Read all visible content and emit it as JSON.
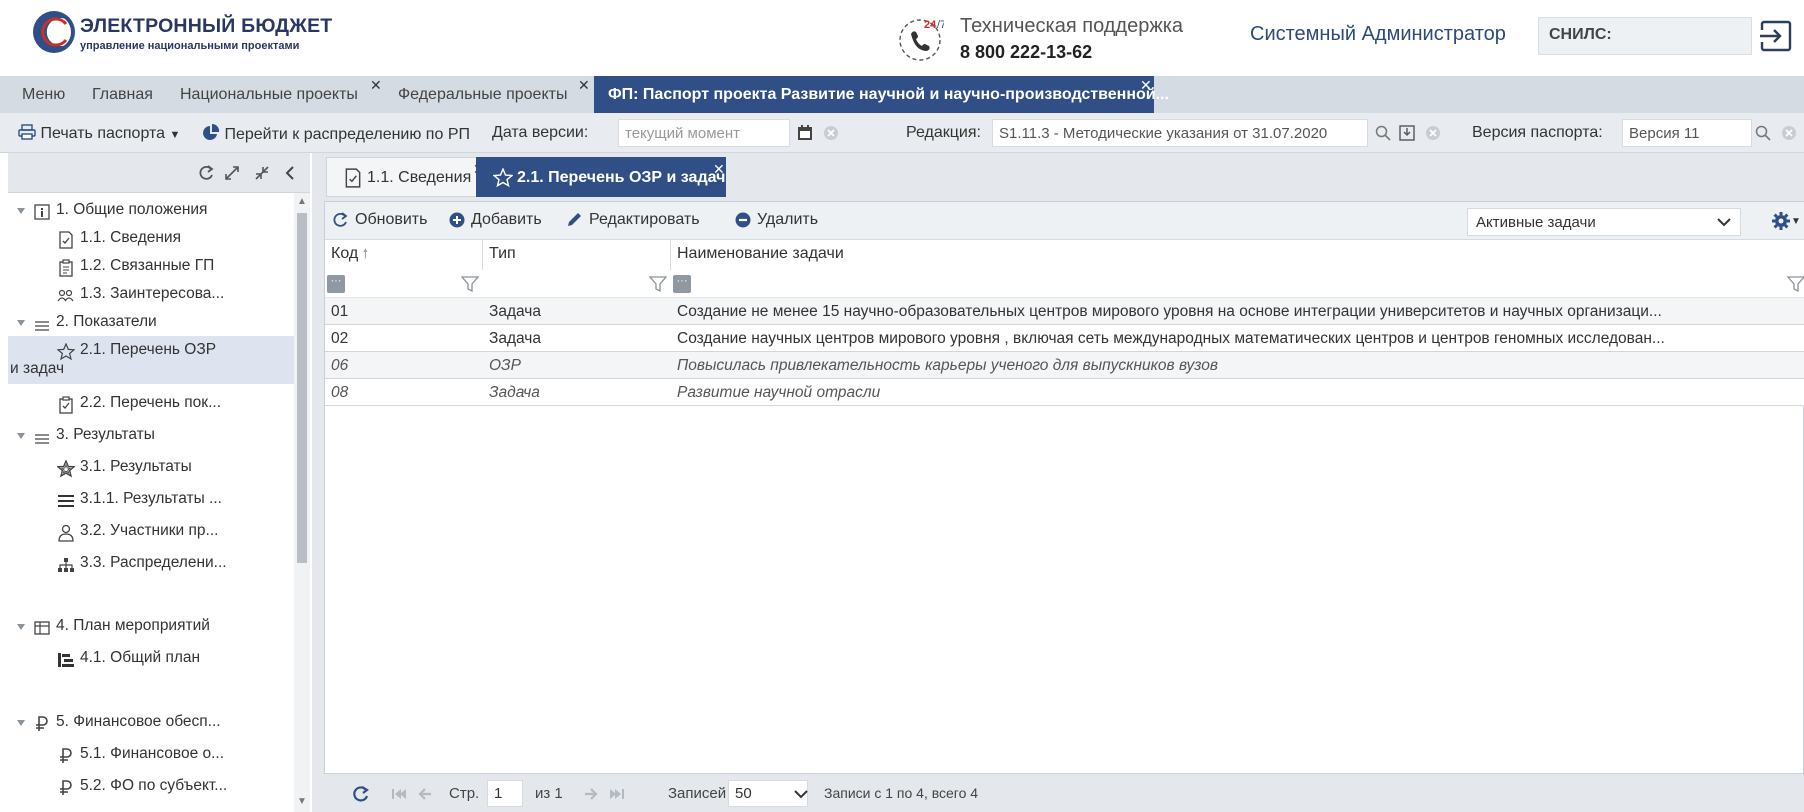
{
  "header": {
    "logo_title": "ЭЛЕКТРОННЫЙ БЮДЖЕТ",
    "logo_subtitle": "управление национальными проектами",
    "support_badge": "24/7",
    "support_title": "Техническая поддержка",
    "support_phone": "8 800 222-13-62",
    "user_name": "Системный Администратор",
    "snils_label": "СНИЛС:"
  },
  "main_tabs": [
    {
      "label": "Меню"
    },
    {
      "label": "Главная"
    },
    {
      "label": "Национальные проекты"
    },
    {
      "label": "Федеральные проекты"
    },
    {
      "label": "ФП: Паспорт проекта Развитие научной и научно-производственной..."
    }
  ],
  "toolbar": {
    "print_label": "Печать паспорта",
    "distribute_label": "Перейти к распределению по РП",
    "version_date_label": "Дата версии:",
    "version_date_placeholder": "текущий момент",
    "edition_label": "Редакция:",
    "edition_value": "S1.11.3 - Методические указания от 31.07.2020",
    "passport_version_label": "Версия паспорта:",
    "passport_version_value": "Версия 11"
  },
  "tree": [
    {
      "label": "1. Общие положения",
      "icon": "info-box-icon",
      "level": 0,
      "expanded": true
    },
    {
      "label": "1.1. Сведения",
      "icon": "doc-check-icon",
      "level": 1
    },
    {
      "label": "1.2. Связанные ГП",
      "icon": "clipboard-icon",
      "level": 1
    },
    {
      "label": "1.3. Заинтересова...",
      "icon": "people-icon",
      "level": 1
    },
    {
      "label": "2. Показатели",
      "icon": "lines-icon",
      "level": 0,
      "expanded": true
    },
    {
      "label": "2.1. Перечень ОЗР",
      "label2": "и задач",
      "icon": "star-icon",
      "level": 1,
      "selected": true
    },
    {
      "label": "2.2. Перечень пок...",
      "icon": "clipboard-check-icon",
      "level": 1
    },
    {
      "label": "3. Результаты",
      "icon": "lines-icon",
      "level": 0,
      "expanded": true
    },
    {
      "label": "3.1. Результаты",
      "icon": "star-outline-icon",
      "level": 1
    },
    {
      "label": "3.1.1. Результаты ...",
      "icon": "list-icon",
      "level": 1
    },
    {
      "label": "3.2. Участники пр...",
      "icon": "person-icon",
      "level": 1
    },
    {
      "label": "3.3. Распределени...",
      "icon": "hierarchy-icon",
      "level": 1
    },
    {
      "label": "4. План мероприятий",
      "icon": "table-icon",
      "level": 0,
      "expanded": true
    },
    {
      "label": "4.1. Общий план",
      "icon": "gantt-icon",
      "level": 1
    },
    {
      "label": "5. Финансовое обесп...",
      "icon": "ruble-icon",
      "level": 0,
      "expanded": true
    },
    {
      "label": "5.1. Финансовое о...",
      "icon": "ruble-icon",
      "level": 1
    },
    {
      "label": "5.2. ФО по субъект...",
      "icon": "ruble-icon",
      "level": 1
    }
  ],
  "sub_tabs": [
    {
      "label": "1.1. Сведения"
    },
    {
      "label": "2.1. Перечень ОЗР и задач"
    }
  ],
  "grid_toolbar": {
    "refresh": "Обновить",
    "add": "Добавить",
    "edit": "Редактировать",
    "delete": "Удалить",
    "filter_select": "Активные задачи"
  },
  "columns": [
    "Код",
    "Тип",
    "Наименование задачи"
  ],
  "rows": [
    {
      "code": "01",
      "type": "Задача",
      "name": "Создание не менее 15 научно-образовательных центров мирового уровня на основе интеграции университетов и научных организаци...",
      "italic": false
    },
    {
      "code": "02",
      "type": "Задача",
      "name": "Создание научных центров мирового уровня , включая сеть международных математических центров и центров геномных исследован...",
      "italic": false
    },
    {
      "code": "06",
      "type": "ОЗР",
      "name": "Повысилась привлекательность карьеры ученого для выпускников вузов",
      "italic": true
    },
    {
      "code": "08",
      "type": "Задача",
      "name": "Развитие научной отрасли",
      "italic": true
    }
  ],
  "pager": {
    "page_label": "Стр.",
    "page_value": "1",
    "of_label": "из 1",
    "records_label": "Записей",
    "records_value": "50",
    "summary": "Записи с 1 по 4, всего 4"
  },
  "colors": {
    "brand_dark": "#2f4f86",
    "header_text": "#2a3760",
    "selected_row": "#dde3ef"
  }
}
